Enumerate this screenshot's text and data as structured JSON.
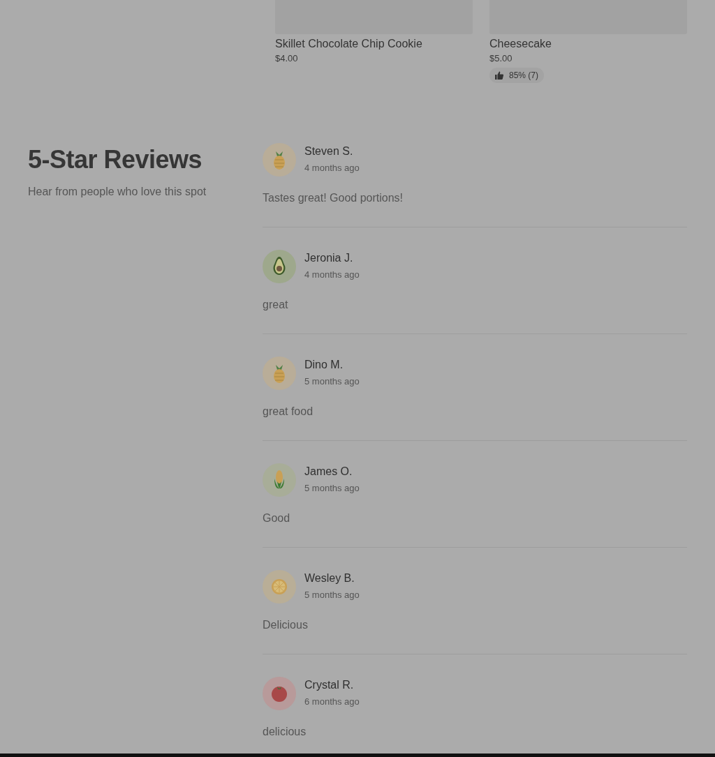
{
  "products": [
    {
      "name": "Skillet Chocolate Chip Cookie",
      "price": "$4.00"
    },
    {
      "name": "Cheesecake",
      "price": "$5.00",
      "rating": "85% (7)"
    }
  ],
  "reviews_section": {
    "title": "5-Star Reviews",
    "subtitle": "Hear from people who love this spot"
  },
  "reviews": [
    {
      "kind": "pineapple",
      "name": "Steven S.",
      "time": "4 months ago",
      "text": "Tastes great! Good portions!"
    },
    {
      "kind": "avocado",
      "name": "Jeronia J.",
      "time": "4 months ago",
      "text": "great"
    },
    {
      "kind": "pineapple",
      "name": "Dino M.",
      "time": "5 months ago",
      "text": "great food"
    },
    {
      "kind": "corn",
      "name": "James O.",
      "time": "5 months ago",
      "text": "Good"
    },
    {
      "kind": "orange",
      "name": "Wesley B.",
      "time": "5 months ago",
      "text": "Delicious"
    },
    {
      "kind": "tomato",
      "name": "Crystal R.",
      "time": "6 months ago",
      "text": "delicious"
    }
  ]
}
